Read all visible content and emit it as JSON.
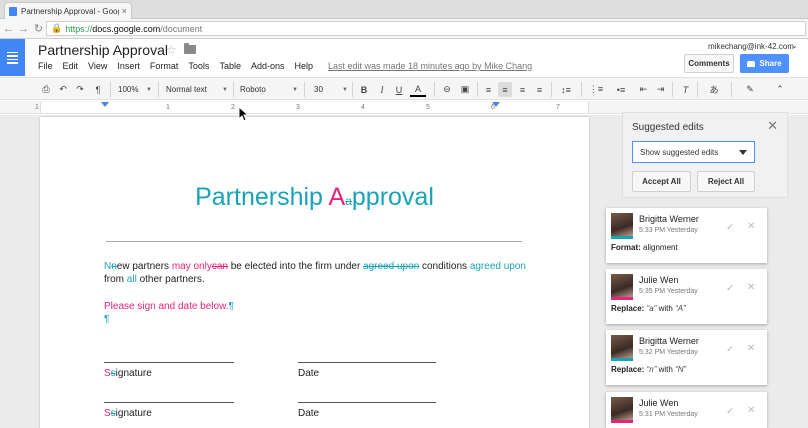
{
  "browser": {
    "tab_title": "Partnership Approval - Google",
    "tab_close": "×",
    "url_proto": "https://",
    "url_host": "docs.google.com",
    "url_path": "/document"
  },
  "header": {
    "doc_title": "Partnership Approval",
    "menu": [
      "File",
      "Edit",
      "View",
      "Insert",
      "Format",
      "Tools",
      "Table",
      "Add-ons",
      "Help"
    ],
    "last_edit": "Last edit was made 18 minutes ago by Mike Chang",
    "user_email": "mikechang@ink-42.com",
    "comments_label": "Comments",
    "share_label": "Share"
  },
  "toolbar": {
    "zoom": "100%",
    "style": "Normal text",
    "font": "Roboto",
    "size": "30"
  },
  "ruler": {
    "numbers": [
      "1",
      "2",
      "3",
      "4",
      "5",
      "6",
      "7"
    ]
  },
  "document": {
    "heading_a": "Partnership ",
    "heading_ins": "A",
    "heading_del": "a",
    "heading_rest": "pproval",
    "p1": {
      "ins_N": "N",
      "del_n": "n",
      "t1": "ew partners ",
      "ins_may_only": "may only",
      "del_can": "can",
      "t2": " be elected into the firm under ",
      "del_agreed": "agreed upon",
      "t3": " conditions ",
      "ins_agreed": "agreed upon",
      "t4": "from ",
      "ins_all": "all",
      "t5": " other partners."
    },
    "p2": "Please sign and date below.",
    "pilcrow": "¶",
    "sig1": {
      "ins": "S",
      "del": "s",
      "rest": "ignature",
      "date": "Date"
    },
    "sig2": {
      "ins": "S",
      "del": "s",
      "rest": "ignature",
      "date": "Date"
    }
  },
  "suggested_panel": {
    "title": "Suggested edits",
    "dropdown_value": "Show suggested edits",
    "accept_all": "Accept All",
    "reject_all": "Reject All"
  },
  "suggestions": [
    {
      "name": "Brigitta Werner",
      "time": "5:33 PM Yesterday",
      "action": "Format:",
      "detail": "alignment",
      "edge": "teal"
    },
    {
      "name": "Julie Wen",
      "time": "5:35 PM Yesterday",
      "action": "Replace:",
      "from": "“a”",
      "with": "with",
      "to": "“A”",
      "edge": "pink"
    },
    {
      "name": "Brigitta Werner",
      "time": "5:32 PM Yesterday",
      "action": "Replace:",
      "from": "“n”",
      "with": "with",
      "to": "“N”",
      "edge": "teal"
    },
    {
      "name": "Julie Wen",
      "time": "5:31 PM Yesterday",
      "edge": "pink"
    }
  ],
  "colors": {
    "accent_blue": "#4285f4",
    "suggestion_pink": "#e8247a",
    "suggestion_teal": "#1aa3b8"
  }
}
